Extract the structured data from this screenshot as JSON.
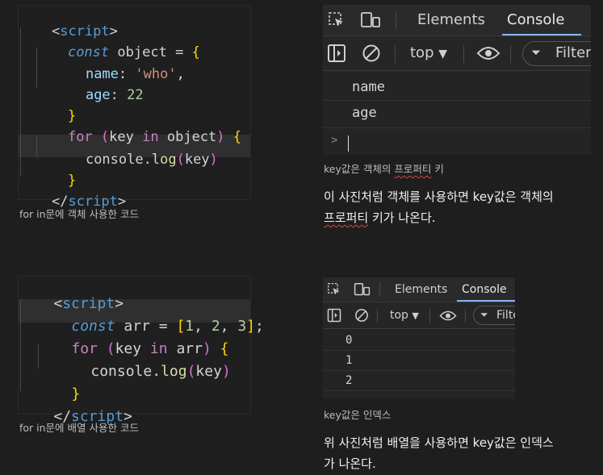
{
  "block1": {
    "code": {
      "open_tag": "<",
      "open_name": "script",
      "open_close": ">",
      "line2": {
        "kw": "const",
        "var": "object",
        "op": "=",
        "brace": "{"
      },
      "line3": {
        "prop": "name",
        "colon": ":",
        "str": "'who'",
        "comma": ","
      },
      "line4": {
        "prop": "age",
        "colon": ":",
        "num": "22"
      },
      "line5": {
        "brace": "}"
      },
      "line6": {
        "kw": "for",
        "p1": "(",
        "key": "key",
        "in": "in",
        "obj": "object",
        "p2": ")",
        "brace": "{"
      },
      "line7": {
        "console": "console",
        "dot": ".",
        "fn": "log",
        "p1": "(",
        "arg": "key",
        "p2": ")"
      },
      "line8": {
        "brace": "}"
      },
      "close_tag": "</",
      "close_name": "script",
      "close_close": ">"
    },
    "caption": "for in문에 객체 사용한 코드",
    "devtools": {
      "tabs": [
        "Elements",
        "Console"
      ],
      "context": "top",
      "filter": "Filter",
      "output": [
        "name",
        "age"
      ],
      "prompt": ">"
    },
    "devtools_caption": {
      "pre": "key값은 객체의 ",
      "squig": "프로퍼티",
      "post": " 키"
    },
    "paragraph": {
      "line1": "이 사진처럼 객체를 사용하면 key값은 객체의",
      "squig": "프로퍼티",
      "line2_post": " 키가 나온다."
    }
  },
  "block2": {
    "code": {
      "open_tag": "<",
      "open_name": "script",
      "open_close": ">",
      "line2": {
        "kw": "const",
        "var": "arr",
        "op": "=",
        "lb": "[",
        "n1": "1",
        "c1": ",",
        "n2": "2",
        "c2": ",",
        "n3": "3",
        "rb": "]",
        "semi": ";"
      },
      "line3": {
        "kw": "for",
        "p1": "(",
        "key": "key",
        "in": "in",
        "obj": "arr",
        "p2": ")",
        "brace": "{"
      },
      "line4": {
        "console": "console",
        "dot": ".",
        "fn": "log",
        "p1": "(",
        "arg": "key",
        "p2": ")"
      },
      "line5": {
        "brace": "}"
      },
      "close_tag": "</",
      "close_name": "script",
      "close_close": ">"
    },
    "caption": "for in문에 배열 사용한 코드",
    "devtools": {
      "tabs": [
        "Elements",
        "Console"
      ],
      "context": "top",
      "filter": "Filte",
      "output": [
        "0",
        "1",
        "2"
      ]
    },
    "devtools_caption": "key값은 인덱스",
    "paragraph": {
      "line1": "위 사진처럼 배열을 사용하면 key값은 인덱스",
      "line2": "가 나온다."
    }
  },
  "icons": {
    "inspect": "inspect-icon",
    "device": "device-toggle-icon",
    "sidebar": "sidebar-icon",
    "clear": "clear-console-icon",
    "eye": "live-expression-icon",
    "filter": "filter-icon"
  }
}
